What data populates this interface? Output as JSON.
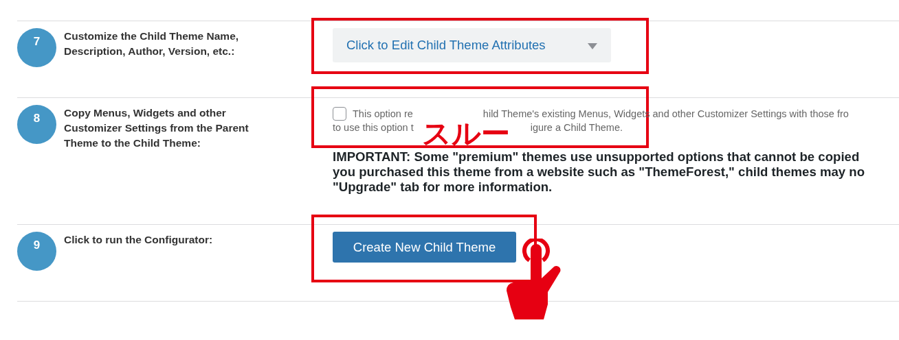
{
  "steps": [
    {
      "number": "7",
      "label": "Customize the Child Theme Name, Description, Author, Version, etc.:",
      "kind": "dropdown",
      "control": {
        "text": "Click to Edit Child Theme Attributes"
      }
    },
    {
      "number": "8",
      "label": "Copy Menus, Widgets and other Customizer Settings from the Parent Theme to the Child Theme:",
      "kind": "checkbox",
      "control": {
        "checked": false,
        "lines": [
          [
            "This option re",
            "hild Theme's existing Menus, Widgets and other Customizer Settings with those fro"
          ],
          [
            "to use this option t",
            "igure a Child Theme."
          ]
        ],
        "important": [
          "IMPORTANT: Some \"premium\" themes use unsupported options that cannot be copied",
          "you purchased this theme from a website such as \"ThemeForest,\" child themes may no",
          "\"Upgrade\" tab for more information."
        ]
      }
    },
    {
      "number": "9",
      "label": "Click to run the Configurator:",
      "kind": "button",
      "control": {
        "text": "Create New Child Theme"
      }
    }
  ],
  "annotation": {
    "note": "スルー"
  }
}
